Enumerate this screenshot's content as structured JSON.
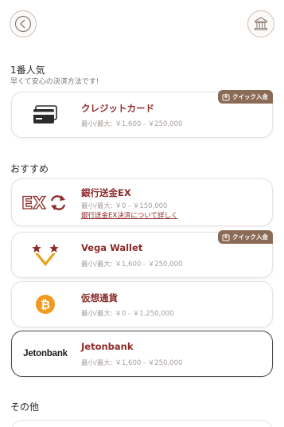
{
  "header": {
    "back_icon": "chevron-left-circle-icon",
    "home_icon": "bank-icon"
  },
  "sections": {
    "popular": {
      "title": "1番人気",
      "subtitle": "早くて安心の決済方法です!"
    },
    "recommended": {
      "title": "おすすめ"
    },
    "other": {
      "title": "その他"
    }
  },
  "badge_label": "クイック入金",
  "methods": [
    {
      "name": "クレジットカード",
      "limit": "最小/最大: ￥1,600 - ￥250,000",
      "icon": "credit-card-icon"
    },
    {
      "name": "銀行送金EX",
      "limit": "最小/最大: ￥0 - ￥150,000",
      "link": "銀行送金EX決済について詳しく",
      "icon": "bank-ex-logo"
    },
    {
      "name": "Vega Wallet",
      "limit": "最小/最大: ￥1,600 - ￥250,000",
      "icon": "vega-wallet-logo"
    },
    {
      "name": "仮想通貨",
      "limit": "最小/最大: ￥0 - ￥1,250,000",
      "icon": "bitcoin-icon"
    },
    {
      "name": "Jetonbank",
      "limit": "最小/最大: ￥1,600 - ￥250,000",
      "logo_text": "Jetonbank",
      "icon": "jetonbank-logo"
    }
  ],
  "colors": {
    "accent": "#8e2a2a",
    "badge": "#8a6b55",
    "bitcoin": "#f29a1f",
    "vega_gold": "#e8a21d"
  }
}
